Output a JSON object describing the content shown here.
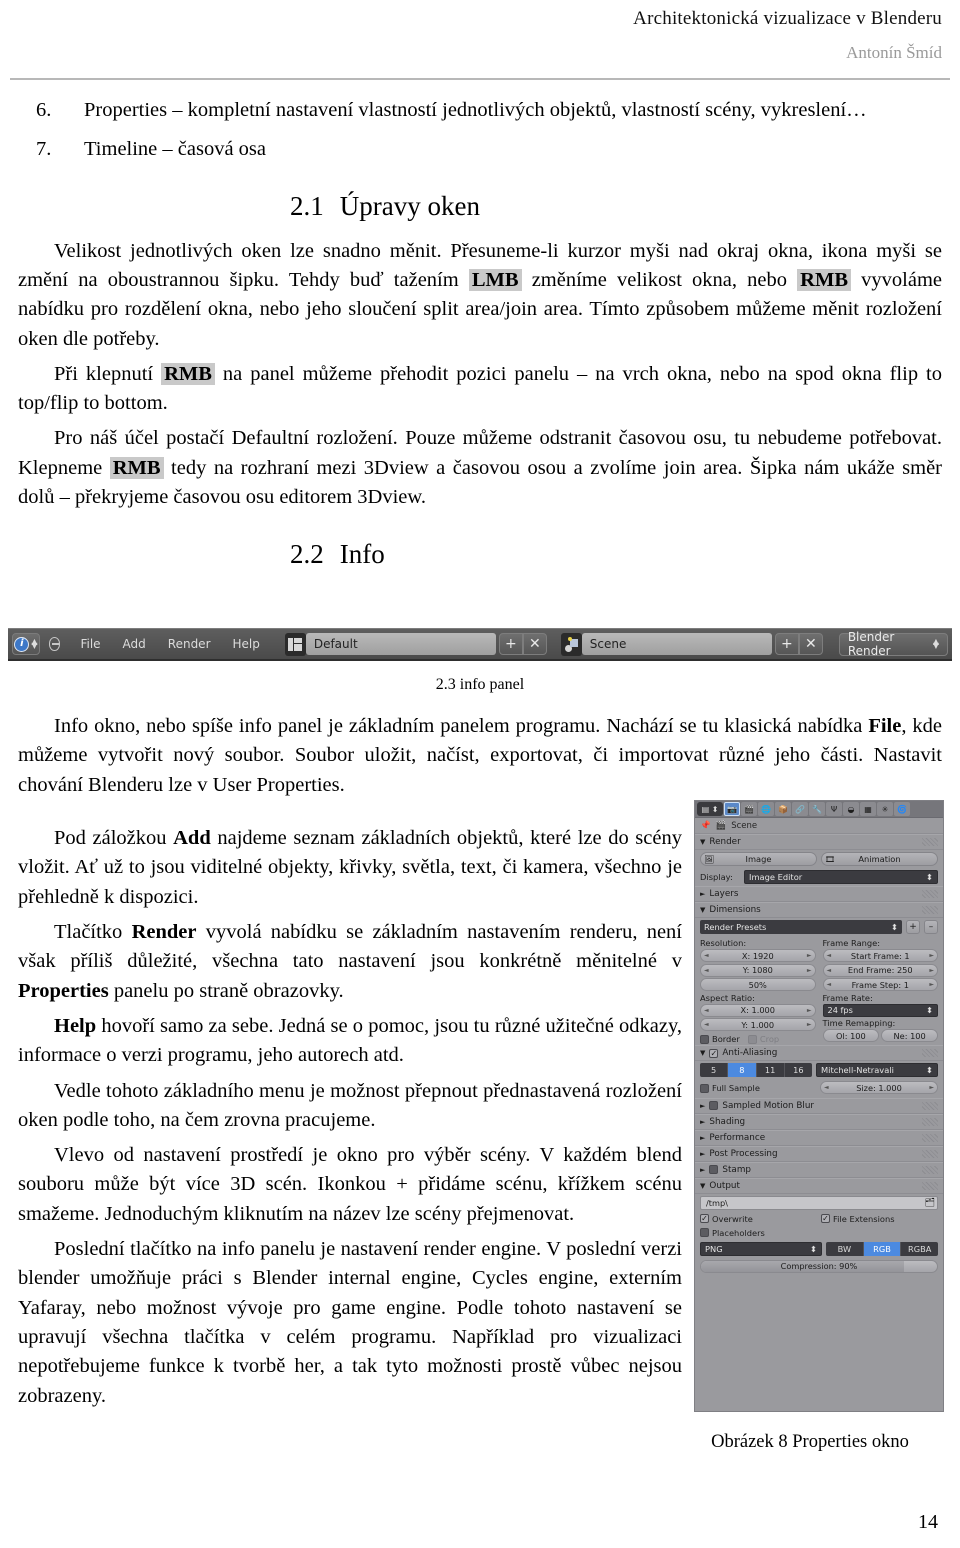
{
  "header": {
    "title": "Architektonická vizualizace v Blenderu",
    "author": "Antonín Šmíd"
  },
  "list_items": [
    {
      "num": "6.",
      "text": "Properties – kompletní nastavení vlastností jednotlivých objektů, vlastností scény, vykreslení…"
    },
    {
      "num": "7.",
      "text": "Timeline – časová osa"
    }
  ],
  "sections": [
    {
      "num": "2.1",
      "title": "Úpravy oken"
    },
    {
      "num": "2.2",
      "title": "Info"
    }
  ],
  "paragraphs": {
    "p1_a": "Velikost jednotlivých oken lze snadno měnit. Přesuneme-li kurzor myši nad okraj okna, ikona myši se změní na oboustrannou šipku. Tehdy buď tažením ",
    "p1_kbd1": "LMB",
    "p1_b": " změníme velikost okna, nebo ",
    "p1_kbd2": "RMB",
    "p1_c": " vyvoláme nabídku pro rozdělení okna, nebo jeho sloučení split area/join area. Tímto způsobem můžeme měnit rozložení oken dle potřeby.",
    "p2_a": "Při klepnutí ",
    "p2_kbd": "RMB",
    "p2_b": " na panel můžeme přehodit pozici panelu – na vrch okna, nebo na spod okna flip to top/flip to bottom.",
    "p3_a": "Pro náš účel postačí Defaultní rozložení. Pouze můžeme odstranit časovou osu, tu nebudeme potřebovat. Klepneme ",
    "p3_kbd": "RMB",
    "p3_b": " tedy na rozhraní mezi 3Dview a časovou osou a zvolíme join area. Šipka nám ukáže směr dolů – překryjeme časovou osu editorem 3Dview.",
    "p4_a": "Info okno, nebo spíše info panel je základním panelem programu. Nachází se tu klasická nabídka ",
    "p4_b1": "File",
    "p4_b": ", kde můžeme vytvořit nový soubor. Soubor uložit, načíst, exportovat, či importovat různé jeho části. Nastavit chování Blenderu lze v User Properties.",
    "p5_a": "Pod záložkou ",
    "p5_b1": "Add",
    "p5_b": " najdeme seznam základních objektů, které lze do scény vložit. Ať už to jsou viditelné objekty, křivky, světla, text, či kamera, všechno je přehledně k dispozici.",
    "p6_a": "Tlačítko ",
    "p6_b1": "Render",
    "p6_b": " vyvolá nabídku se základním nastavením renderu, není však příliš důležité, všechna tato nastavení jsou konkrétně měnitelné v ",
    "p6_b2": "Properties",
    "p6_c": " panelu po straně obrazovky.",
    "p7_b1": "Help",
    "p7_b": " hovoří samo za sebe. Jedná se o pomoc, jsou tu různé užitečné odkazy, informace o verzi programu, jeho autorech atd.",
    "p8": "Vedle tohoto základního menu je možnost přepnout přednastavená rozložení oken podle toho, na čem zrovna pracujeme.",
    "p9": "Vlevo od nastavení prostředí je okno pro výběr scény. V každém blend souboru může být více 3D scén. Ikonkou + přidáme scénu, křížkem scénu smažeme. Jednoduchým kliknutím na název lze scény přejmenovat.",
    "p10": "Poslední tlačítko na info panelu je nastavení render engine. V poslední verzi blender umožňuje práci s Blender internal engine, Cycles engine, externím Yafaray, nebo možnost vývoje pro game engine. Podle tohoto nastavení se upravují všechna tlačítka v celém programu. Například pro vizualizaci nepotřebujeme funkce k tvorbě her, a tak tyto možnosti prostě vůbec nejsou zobrazeny."
  },
  "info_panel": {
    "caption": "2.3 info panel",
    "editor_icon": "info-icon",
    "menus": [
      "File",
      "Add",
      "Render",
      "Help"
    ],
    "layout_value": "Default",
    "scene_value": "Scene",
    "engine_value": "Blender Render",
    "add_label": "+",
    "remove_label": "✕"
  },
  "properties_panel": {
    "caption": "Obrázek 8 Properties okno",
    "breadcrumb": "Scene",
    "tabs": [
      "render-tab",
      "scene-tab",
      "world-tab",
      "object-tab",
      "constraints-tab",
      "modifiers-tab",
      "data-tab",
      "material-tab",
      "texture-tab",
      "particles-tab",
      "physics-tab"
    ],
    "render": {
      "title": "Render",
      "image_button": "Image",
      "animation_button": "Animation",
      "display_label": "Display:",
      "display_value": "Image Editor"
    },
    "layers": {
      "title": "Layers"
    },
    "dimensions": {
      "title": "Dimensions",
      "presets": "Render Presets",
      "resolution_label": "Resolution:",
      "res_x": "X: 1920",
      "res_y": "Y: 1080",
      "res_percent": "50%",
      "aspect_label": "Aspect Ratio:",
      "aspect_x": "X: 1.000",
      "aspect_y": "Y: 1.000",
      "border": "Border",
      "crop": "Crop",
      "frame_range_label": "Frame Range:",
      "start_frame": "Start Frame: 1",
      "end_frame": "End Frame: 250",
      "frame_step": "Frame Step: 1",
      "frame_rate_label": "Frame Rate:",
      "fps": "24 fps",
      "time_remapping_label": "Time Remapping:",
      "old": "Ol: 100",
      "new": "Ne: 100"
    },
    "antialiasing": {
      "title": "Anti-Aliasing",
      "samples": [
        "5",
        "8",
        "11",
        "16"
      ],
      "selected_sample": "8",
      "filter": "Mitchell-Netravali",
      "full_sample": "Full Sample",
      "size": "Size: 1.000"
    },
    "collapsed": [
      "Sampled Motion Blur",
      "Shading",
      "Performance",
      "Post Processing",
      "Stamp"
    ],
    "output": {
      "title": "Output",
      "path": "/tmp\\",
      "overwrite": "Overwrite",
      "file_extensions": "File Extensions",
      "placeholders": "Placeholders",
      "format": "PNG",
      "color_modes": [
        "BW",
        "RGB",
        "RGBA"
      ],
      "selected_color_mode": "RGB",
      "compression": "Compression: 90%"
    }
  },
  "page_number": "14"
}
